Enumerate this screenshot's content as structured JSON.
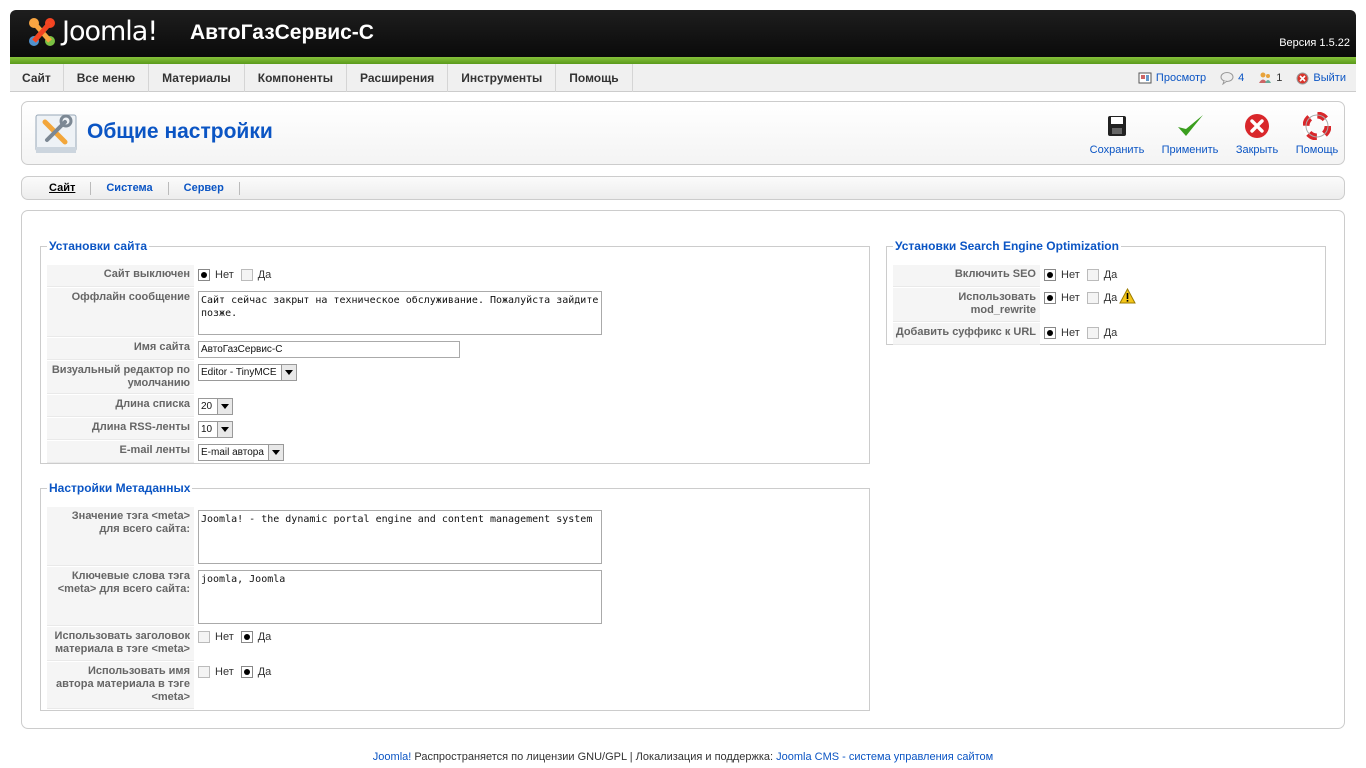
{
  "header": {
    "logo_text": "Joomla!",
    "site_title": "АвтоГазСервис-С",
    "version": "Версия 1.5.22"
  },
  "menu": [
    "Сайт",
    "Все меню",
    "Материалы",
    "Компоненты",
    "Расширения",
    "Инструменты",
    "Помощь"
  ],
  "status": {
    "preview": "Просмотр",
    "messages": "4",
    "users": "1",
    "logout": "Выйти"
  },
  "toolbar": {
    "page_title": "Общие настройки",
    "save": "Сохранить",
    "apply": "Применить",
    "close": "Закрыть",
    "help": "Помощь"
  },
  "tabs": [
    "Сайт",
    "Система",
    "Сервер"
  ],
  "site_settings": {
    "legend": "Установки сайта",
    "offline_label": "Сайт выключен",
    "no": "Нет",
    "yes": "Да",
    "offline_msg_label": "Оффлайн сообщение",
    "offline_msg": "Сайт сейчас закрыт на техническое обслуживание. Пожалуйста зайдите позже.",
    "sitename_label": "Имя сайта",
    "sitename": "АвтоГазСервис-С",
    "editor_label": "Визуальный редактор по умолчанию",
    "editor": "Editor - TinyMCE",
    "list_label": "Длина списка",
    "list": "20",
    "rss_label": "Длина RSS-ленты",
    "rss": "10",
    "email_label": "E-mail ленты",
    "email": "E-mail автора"
  },
  "meta_settings": {
    "legend": "Настройки Метаданных",
    "desc_label": "Значение тэга <meta> для всего сайта:",
    "desc": "Joomla! - the dynamic portal engine and content management system",
    "keys_label": "Ключевые слова тэга <meta> для всего сайта:",
    "keys": "joomla, Joomla",
    "title_label": "Использовать заголовок материала в тэге <meta>",
    "author_label": "Использовать имя автора материала в тэге <meta>"
  },
  "seo": {
    "legend": "Установки Search Engine Optimization",
    "sef_label": "Включить SEO",
    "rewrite_label": "Использовать mod_rewrite",
    "suffix_label": "Добавить суффикс к URL"
  },
  "footer": {
    "joomla": "Joomla!",
    "license": " Распространяется по лицензии GNU/GPL | Локализация и поддержка: ",
    "link": "Joomla CMS - система управления сайтом"
  }
}
